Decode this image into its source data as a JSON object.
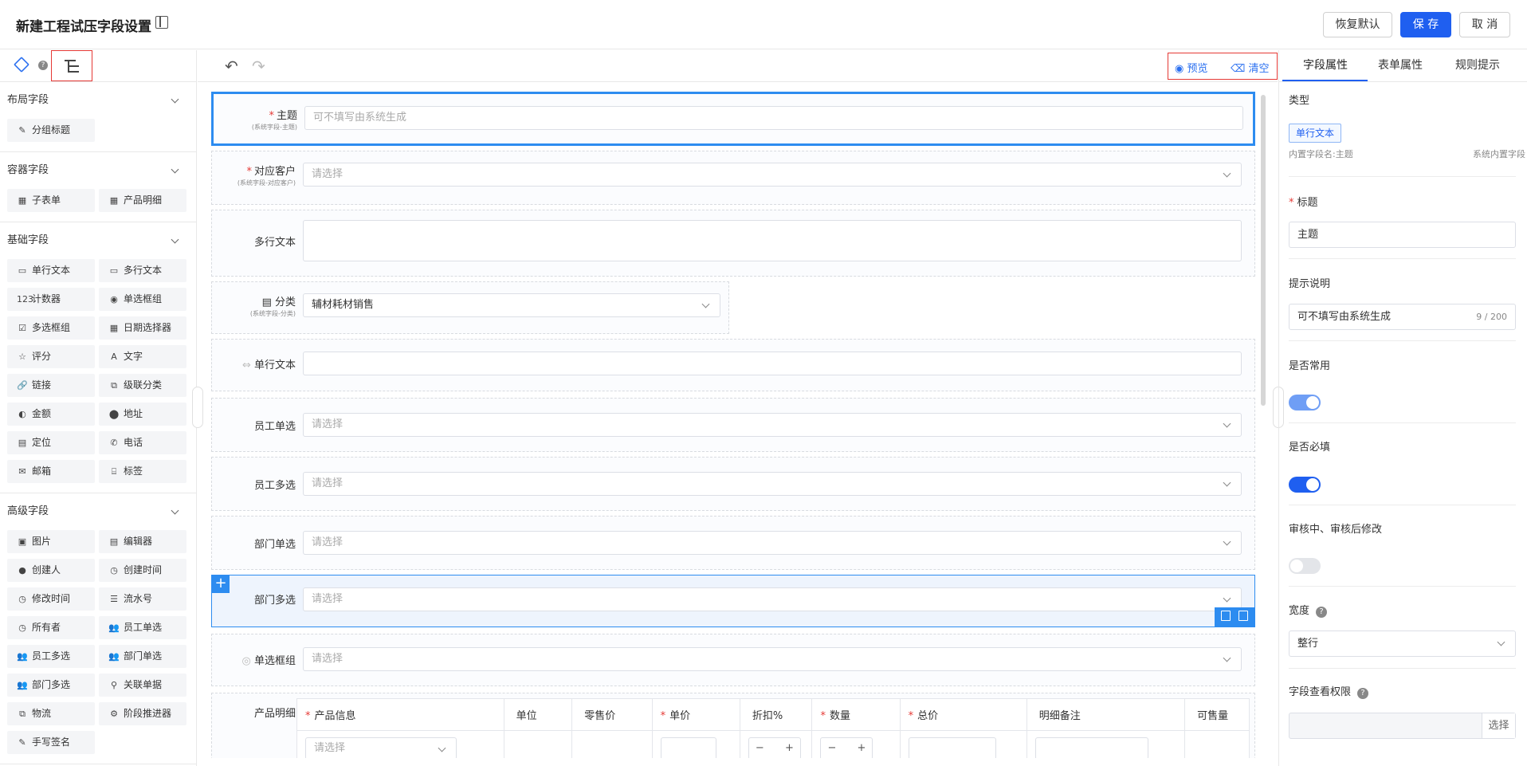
{
  "header": {
    "title": "新建工程试压字段设置",
    "restore_label": "恢复默认",
    "save_label": "保 存",
    "cancel_label": "取 消"
  },
  "left_panel": {
    "help_mark": "?",
    "groups": [
      {
        "title": "布局字段",
        "items": [
          {
            "icon": "✎",
            "label": "分组标题"
          }
        ]
      },
      {
        "title": "容器字段",
        "items": [
          {
            "icon": "▦",
            "label": "子表单"
          },
          {
            "icon": "▦",
            "label": "产品明细"
          }
        ]
      },
      {
        "title": "基础字段",
        "items": [
          {
            "icon": "▭",
            "label": "单行文本"
          },
          {
            "icon": "▭",
            "label": "多行文本"
          },
          {
            "icon": "123",
            "label": "计数器"
          },
          {
            "icon": "◉",
            "label": "单选框组"
          },
          {
            "icon": "☑",
            "label": "多选框组"
          },
          {
            "icon": "▦",
            "label": "日期选择器"
          },
          {
            "icon": "☆",
            "label": "评分"
          },
          {
            "icon": "A",
            "label": "文字"
          },
          {
            "icon": "🔗",
            "label": "链接"
          },
          {
            "icon": "⧉",
            "label": "级联分类"
          },
          {
            "icon": "◐",
            "label": "金额"
          },
          {
            "icon": "⬤",
            "label": "地址"
          },
          {
            "icon": "▤",
            "label": "定位"
          },
          {
            "icon": "✆",
            "label": "电话"
          },
          {
            "icon": "✉",
            "label": "邮箱"
          },
          {
            "icon": "⌸",
            "label": "标签"
          }
        ]
      },
      {
        "title": "高级字段",
        "items": [
          {
            "icon": "▣",
            "label": "图片"
          },
          {
            "icon": "▤",
            "label": "编辑器"
          },
          {
            "icon": "●",
            "label": "创建人"
          },
          {
            "icon": "◷",
            "label": "创建时间"
          },
          {
            "icon": "◷",
            "label": "修改时间"
          },
          {
            "icon": "☰",
            "label": "流水号"
          },
          {
            "icon": "◷",
            "label": "所有者"
          },
          {
            "icon": "👥",
            "label": "员工单选"
          },
          {
            "icon": "👥",
            "label": "员工多选"
          },
          {
            "icon": "👥",
            "label": "部门单选"
          },
          {
            "icon": "👥",
            "label": "部门多选"
          },
          {
            "icon": "⚲",
            "label": "关联单据"
          },
          {
            "icon": "⧉",
            "label": "物流"
          },
          {
            "icon": "⚙",
            "label": "阶段推进器"
          },
          {
            "icon": "✎",
            "label": "手写签名"
          }
        ]
      }
    ]
  },
  "toolbar": {
    "undo": "↶",
    "redo": "↷",
    "preview_label": "预览",
    "clear_label": "清空"
  },
  "canvas": {
    "subject": {
      "label": "主题",
      "sub": "(系统字段-主题)",
      "placeholder": "可不填写由系统生成"
    },
    "customer": {
      "label": "对应客户",
      "sub": "(系统字段-对应客户)",
      "placeholder": "请选择"
    },
    "multiline": {
      "label": "多行文本"
    },
    "category": {
      "label": "分类",
      "sub": "(系统字段-分类)",
      "value": "辅材耗材销售"
    },
    "single_text": {
      "label": "单行文本"
    },
    "emp_single": {
      "label": "员工单选",
      "placeholder": "请选择"
    },
    "emp_multi": {
      "label": "员工多选",
      "placeholder": "请选择"
    },
    "dept_single": {
      "label": "部门单选",
      "placeholder": "请选择"
    },
    "dept_multi": {
      "label": "部门多选",
      "placeholder": "请选择"
    },
    "radio_group": {
      "label": "单选框组",
      "placeholder": "请选择"
    },
    "product_detail": {
      "label": "产品明细",
      "columns": [
        {
          "label": "产品信息",
          "required": "*"
        },
        {
          "label": "单位",
          "required": ""
        },
        {
          "label": "零售价",
          "required": ""
        },
        {
          "label": "单价",
          "required": "*"
        },
        {
          "label": "折扣%",
          "required": ""
        },
        {
          "label": "数量",
          "required": "*"
        },
        {
          "label": "总价",
          "required": "*"
        },
        {
          "label": "明细备注",
          "required": ""
        },
        {
          "label": "可售量",
          "required": ""
        }
      ],
      "row_placeholder": "请选择",
      "minus": "−",
      "plus": "+"
    }
  },
  "right_panel": {
    "tabs": [
      "字段属性",
      "表单属性",
      "规则提示"
    ],
    "type_label": "类型",
    "type_tag": "单行文本",
    "builtin_name": "内置字段名:主题",
    "builtin_kind": "系统内置字段",
    "title_label": "标题",
    "title_value": "主题",
    "hint_label": "提示说明",
    "hint_value": "可不填写由系统生成",
    "hint_counter": "9 / 200",
    "common_label": "是否常用",
    "required_label": "是否必填",
    "edit_label": "审核中、审核后修改",
    "width_label": "宽度",
    "width_value": "整行",
    "perm_label": "字段查看权限",
    "perm_button": "选择",
    "help_mark": "?",
    "required_mark": "*",
    "colors": {
      "accent": "#1f5ff0",
      "switch_on_light": "#6f9ef5",
      "switch_off": "#e3e5e9"
    }
  }
}
